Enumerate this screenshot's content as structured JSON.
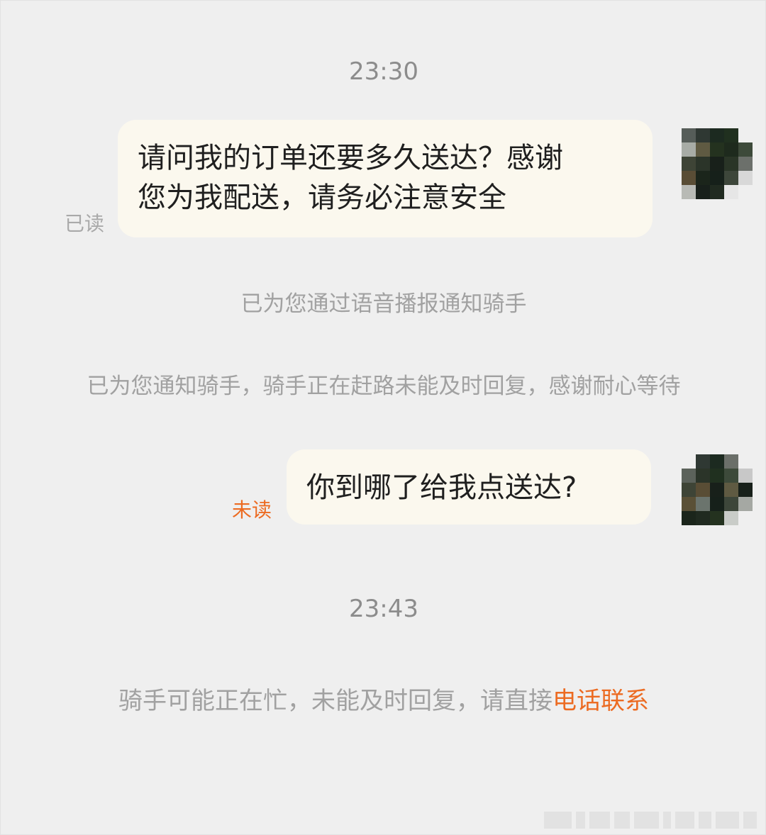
{
  "chat": {
    "timestamp_1": "23:30",
    "message_1": {
      "line_1": "请问我的订单还要多久送达？感谢",
      "line_2": "您为我配送，请务必注意安全",
      "status": "已读"
    },
    "system_1": "已为您通过语音播报通知骑手",
    "system_2": "已为您通知骑手，骑手正在赶路未能及时回复，感谢耐心等待",
    "message_2": {
      "text": "你到哪了给我点送达?",
      "status": "未读"
    },
    "timestamp_2": "23:43",
    "notice": {
      "text": "骑手可能正在忙，未能及时回复，请直接",
      "link": "电话联系"
    }
  },
  "colors": {
    "background": "#efefef",
    "bubble": "#fbf8ee",
    "accent": "#ec6b22",
    "muted_text": "#a1a1a1"
  },
  "icons": {
    "avatar": "pixelated-user-avatar"
  }
}
